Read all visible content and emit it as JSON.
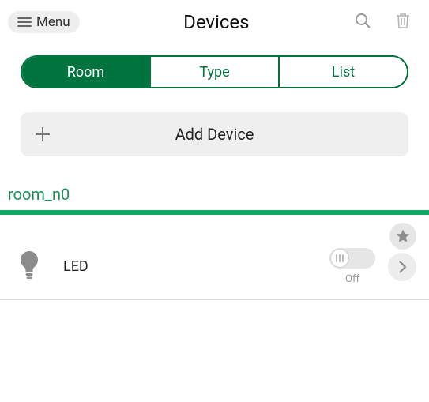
{
  "header": {
    "menu_label": "Menu",
    "title": "Devices"
  },
  "tabs": {
    "items": [
      {
        "label": "Room",
        "active": true
      },
      {
        "label": "Type",
        "active": false
      },
      {
        "label": "List",
        "active": false
      }
    ]
  },
  "add_device_label": "Add Device",
  "room": {
    "name": "room_n0"
  },
  "devices": [
    {
      "name": "LED",
      "state_label": "Off",
      "is_on": false,
      "favorite": false
    }
  ],
  "colors": {
    "accent": "#00733f",
    "divider": "#11a862"
  }
}
